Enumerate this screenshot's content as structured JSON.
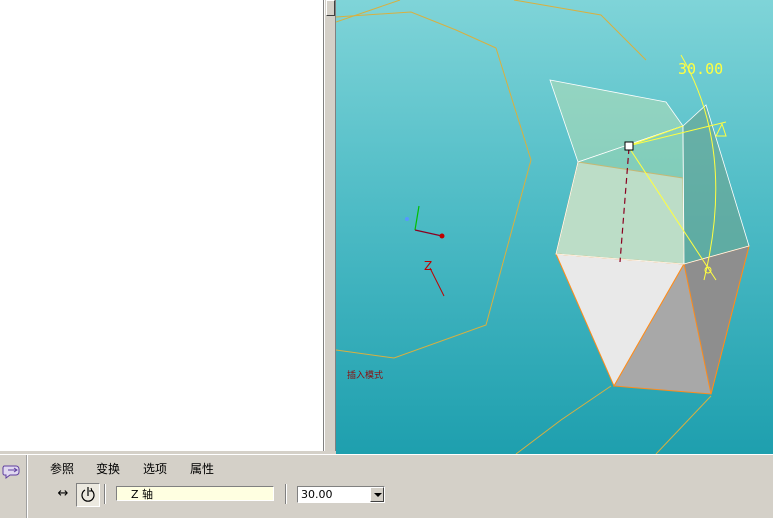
{
  "viewport": {
    "angle_label": "30.00",
    "axis_label": "Z",
    "mode_text": "插入模式"
  },
  "dashboard": {
    "tabs": [
      "参照",
      "变换",
      "选项",
      "属性"
    ],
    "reference_value": "Z 轴",
    "angle_value": "30.00",
    "move_symbol": "↔"
  },
  "colors": {
    "dimension": "#ffff40",
    "edge_highlight": "#ff8c1a",
    "background_top": "#7fd4d8",
    "background_bottom": "#1e9fae"
  }
}
